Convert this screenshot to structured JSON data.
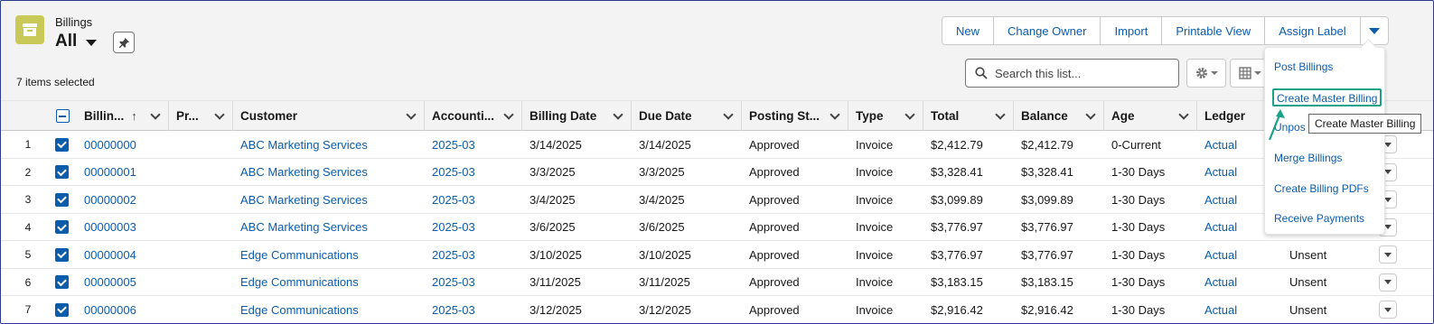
{
  "header": {
    "object_label": "Billings",
    "list_view_name": "All",
    "items_selected": "7 items selected"
  },
  "actions": {
    "buttons": [
      "New",
      "Change Owner",
      "Import",
      "Printable View",
      "Assign Label"
    ]
  },
  "search": {
    "placeholder": "Search this list..."
  },
  "table": {
    "columns": [
      "Billin...",
      "Pr...",
      "Customer",
      "Accounti...",
      "Billing Date",
      "Due Date",
      "Posting St...",
      "Type",
      "Total",
      "Balance",
      "Age",
      "Ledger"
    ],
    "rows": [
      {
        "num": "1",
        "billing": "00000000",
        "customer": "ABC Marketing Services",
        "period": "2025-03",
        "billing_date": "3/14/2025",
        "due_date": "3/14/2025",
        "status": "Approved",
        "type": "Invoice",
        "total": "$2,412.79",
        "balance": "$2,412.79",
        "age": "0-Current",
        "ledger": "Actual",
        "extra": ""
      },
      {
        "num": "2",
        "billing": "00000001",
        "customer": "ABC Marketing Services",
        "period": "2025-03",
        "billing_date": "3/3/2025",
        "due_date": "3/3/2025",
        "status": "Approved",
        "type": "Invoice",
        "total": "$3,328.41",
        "balance": "$3,328.41",
        "age": "1-30 Days",
        "ledger": "Actual",
        "extra": ""
      },
      {
        "num": "3",
        "billing": "00000002",
        "customer": "ABC Marketing Services",
        "period": "2025-03",
        "billing_date": "3/4/2025",
        "due_date": "3/4/2025",
        "status": "Approved",
        "type": "Invoice",
        "total": "$3,099.89",
        "balance": "$3,099.89",
        "age": "1-30 Days",
        "ledger": "Actual",
        "extra": ""
      },
      {
        "num": "4",
        "billing": "00000003",
        "customer": "ABC Marketing Services",
        "period": "2025-03",
        "billing_date": "3/6/2025",
        "due_date": "3/6/2025",
        "status": "Approved",
        "type": "Invoice",
        "total": "$3,776.97",
        "balance": "$3,776.97",
        "age": "1-30 Days",
        "ledger": "Actual",
        "extra": ""
      },
      {
        "num": "5",
        "billing": "00000004",
        "customer": "Edge Communications",
        "period": "2025-03",
        "billing_date": "3/10/2025",
        "due_date": "3/10/2025",
        "status": "Approved",
        "type": "Invoice",
        "total": "$3,776.97",
        "balance": "$3,776.97",
        "age": "1-30 Days",
        "ledger": "Actual",
        "extra": "Unsent"
      },
      {
        "num": "6",
        "billing": "00000005",
        "customer": "Edge Communications",
        "period": "2025-03",
        "billing_date": "3/11/2025",
        "due_date": "3/11/2025",
        "status": "Approved",
        "type": "Invoice",
        "total": "$3,183.15",
        "balance": "$3,183.15",
        "age": "1-30 Days",
        "ledger": "Actual",
        "extra": "Unsent"
      },
      {
        "num": "7",
        "billing": "00000006",
        "customer": "Edge Communications",
        "period": "2025-03",
        "billing_date": "3/12/2025",
        "due_date": "3/12/2025",
        "status": "Approved",
        "type": "Invoice",
        "total": "$2,916.42",
        "balance": "$2,916.42",
        "age": "1-30 Days",
        "ledger": "Actual",
        "extra": "Unsent"
      }
    ]
  },
  "menu": {
    "items": [
      "Post Billings",
      "Create Master Billing",
      "Unpos",
      "Merge Billings",
      "Create Billing PDFs",
      "Receive Payments"
    ],
    "tooltip": "Create Master Billing"
  },
  "colors": {
    "accent": "#0b5cab",
    "object_icon": "#c9c95a",
    "highlight": "#1aa38a"
  },
  "icons": [
    "billing-object-icon",
    "pin-icon",
    "search-icon",
    "gear-icon",
    "table-view-icon",
    "chevron-down-icon",
    "sort-up-icon"
  ]
}
